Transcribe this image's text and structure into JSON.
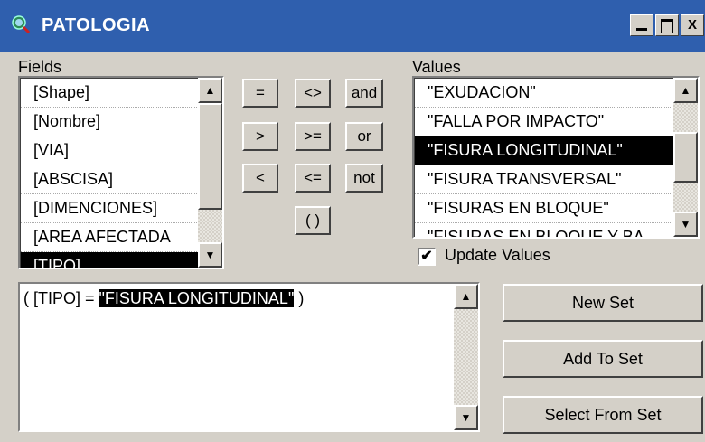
{
  "window": {
    "title": "PATOLOGIA",
    "icon": "query-magnifier-icon",
    "controls": {
      "minimize": "minimize-icon",
      "maximize": "maximize-icon",
      "close": "X"
    }
  },
  "fields": {
    "label": "Fields",
    "items": [
      "[Shape]",
      "[Nombre]",
      "[VIA]",
      "[ABSCISA]",
      "[DIMENCIONES]",
      "[AREA AFECTADA",
      "[TIPO]"
    ],
    "selected": "[TIPO]"
  },
  "operators": {
    "eq": "=",
    "ne": "<>",
    "and": "and",
    "gt": ">",
    "ge": ">=",
    "or": "or",
    "lt": "<",
    "le": "<=",
    "not": "not",
    "paren": "( )"
  },
  "values": {
    "label": "Values",
    "items": [
      "\"EXUDACION\"",
      "\"FALLA POR IMPACTO\"",
      "\"FISURA LONGITUDINAL\"",
      "\"FISURA TRANSVERSAL\"",
      "\"FISURAS EN BLOQUE\"",
      "\"FISURAS EN BLOQUE Y BA"
    ],
    "selected": "\"FISURA LONGITUDINAL\""
  },
  "update_values": {
    "label": "Update Values",
    "checked": true
  },
  "expression": {
    "prefix": "( [TIPO] = ",
    "highlighted": "\"FISURA LONGITUDINAL\"",
    "suffix": " )"
  },
  "buttons": {
    "new_set": "New Set",
    "add_to_set": "Add To Set",
    "select_from_set": "Select From Set"
  }
}
